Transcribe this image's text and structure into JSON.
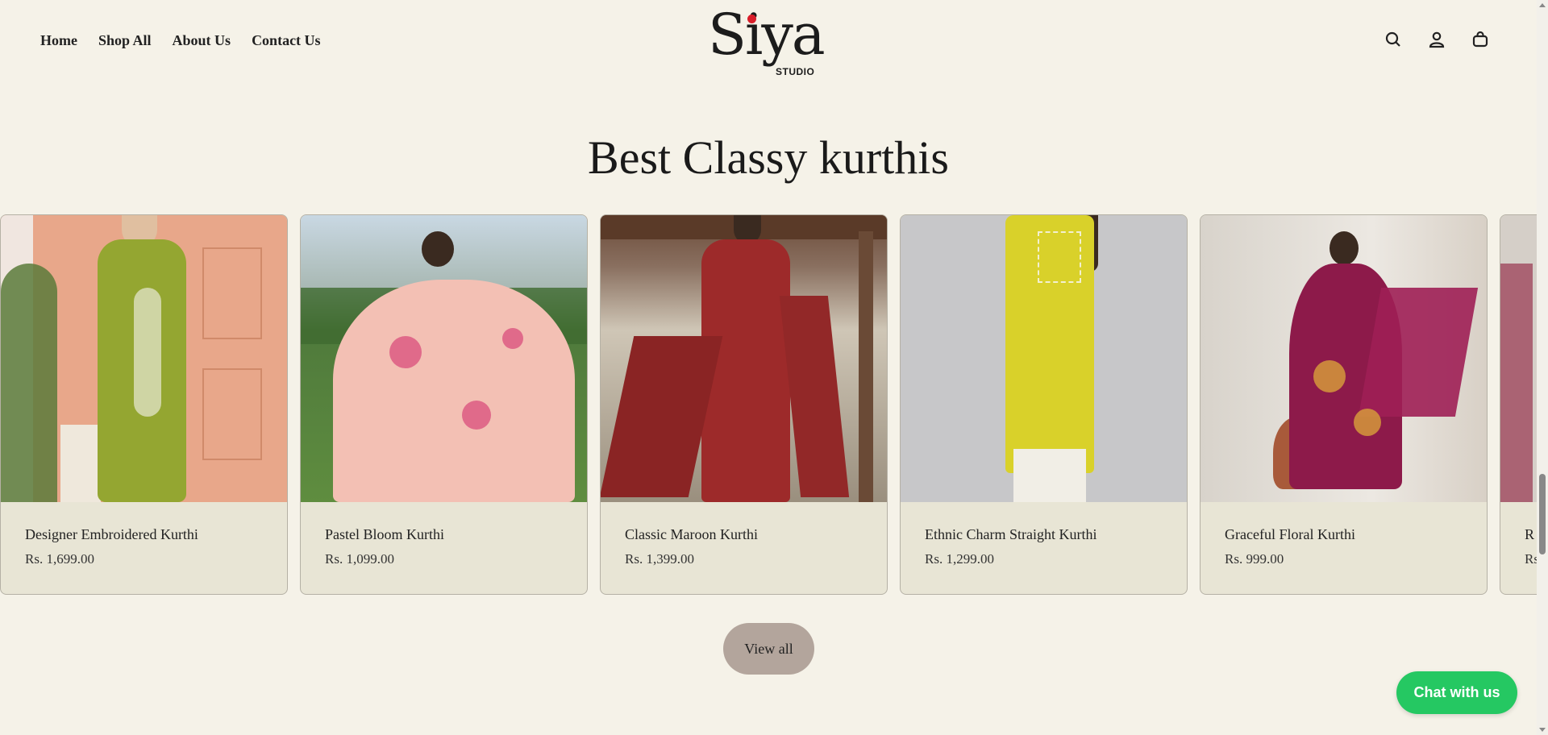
{
  "header": {
    "nav": [
      "Home",
      "Shop All",
      "About Us",
      "Contact Us"
    ],
    "logo": {
      "main": "Siya",
      "sub": "STUDIO"
    },
    "icons": [
      "search-icon",
      "account-icon",
      "cart-icon"
    ]
  },
  "section": {
    "title": "Best Classy kurthis"
  },
  "products": [
    {
      "name": "Designer Embroidered Kurthi",
      "price": "Rs. 1,699.00"
    },
    {
      "name": "Pastel Bloom Kurthi",
      "price": "Rs. 1,099.00"
    },
    {
      "name": "Classic Maroon Kurthi",
      "price": "Rs. 1,399.00"
    },
    {
      "name": "Ethnic Charm Straight Kurthi",
      "price": "Rs. 1,299.00"
    },
    {
      "name": "Graceful Floral Kurthi",
      "price": "Rs. 999.00"
    },
    {
      "name": "R",
      "price": "Rs"
    }
  ],
  "view_all": "View all",
  "chat": "Chat with us",
  "colors": {
    "background": "#f5f2e8",
    "card": "#e8e5d5",
    "chat": "#25c862",
    "view_all": "#b3a59c",
    "logo_dot": "#d91e2a"
  }
}
